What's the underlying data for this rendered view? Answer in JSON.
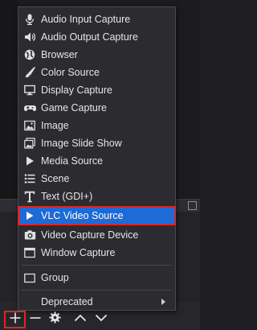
{
  "menu": {
    "items": [
      {
        "label": "Audio Input Capture",
        "icon": "microphone-icon"
      },
      {
        "label": "Audio Output Capture",
        "icon": "speaker-icon"
      },
      {
        "label": "Browser",
        "icon": "globe-icon"
      },
      {
        "label": "Color Source",
        "icon": "brush-icon"
      },
      {
        "label": "Display Capture",
        "icon": "monitor-icon"
      },
      {
        "label": "Game Capture",
        "icon": "gamepad-icon"
      },
      {
        "label": "Image",
        "icon": "image-icon"
      },
      {
        "label": "Image Slide Show",
        "icon": "slideshow-icon"
      },
      {
        "label": "Media Source",
        "icon": "play-icon"
      },
      {
        "label": "Scene",
        "icon": "list-icon"
      },
      {
        "label": "Text (GDI+)",
        "icon": "text-icon"
      },
      {
        "label": "VLC Video Source",
        "icon": "play-icon",
        "selected": true
      },
      {
        "label": "Video Capture Device",
        "icon": "camera-icon"
      },
      {
        "label": "Window Capture",
        "icon": "window-icon"
      }
    ],
    "group": {
      "label": "Group",
      "icon": "folder-icon"
    },
    "deprecated": {
      "label": "Deprecated"
    }
  },
  "toolbar": {
    "add": "add-icon",
    "remove": "minus-icon",
    "properties": "gear-icon",
    "move_up": "chevron-up-icon",
    "move_down": "chevron-down-icon"
  },
  "colors": {
    "menu_bg": "#2b2b30",
    "selection": "#1e6ad6",
    "highlight_border": "#d62828",
    "text": "#e6e6e6"
  }
}
